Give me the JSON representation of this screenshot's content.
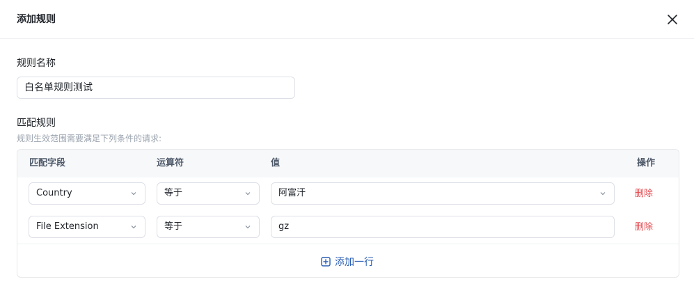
{
  "dialog": {
    "title": "添加规则",
    "close_icon": "close-icon"
  },
  "rule_name": {
    "label": "规则名称",
    "value": "白名单规则测试"
  },
  "match_rules": {
    "label": "匹配规则",
    "hint": "规则生效范围需要满足下列条件的请求:",
    "columns": [
      "匹配字段",
      "运算符",
      "值",
      "操作"
    ],
    "rows": [
      {
        "field": "Country",
        "operator": "等于",
        "value": "阿富汗",
        "value_is_select": true,
        "action": "删除"
      },
      {
        "field": "File Extension",
        "operator": "等于",
        "value": "gz",
        "value_is_select": false,
        "action": "删除"
      }
    ],
    "add_row_label": "添加一行"
  },
  "colors": {
    "accent": "#2b5fb3",
    "danger": "#e5484d",
    "border": "#dcdfe6",
    "header_bg": "#f7f8fa"
  }
}
